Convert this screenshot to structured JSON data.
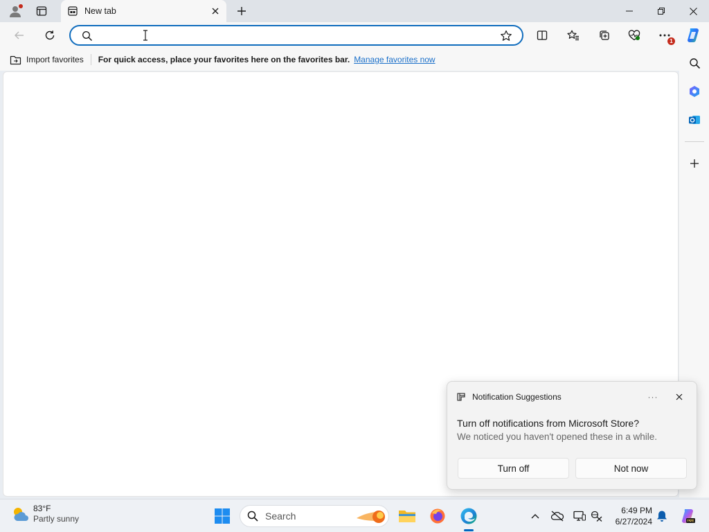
{
  "browser": {
    "tab": {
      "title": "New tab"
    },
    "address_bar": {
      "value": "",
      "placeholder": ""
    },
    "toolbar_icons": [
      "back-icon",
      "refresh-icon",
      "split-screen-icon",
      "favorites-icon",
      "collections-icon",
      "browser-essentials-icon",
      "more-icon",
      "copilot-icon"
    ],
    "settings_badge": "1"
  },
  "favorites_bar": {
    "import_label": "Import favorites",
    "message": "For quick access, place your favorites here on the favorites bar.",
    "link": "Manage favorites now"
  },
  "sidebar": {
    "items": [
      "search-icon",
      "office-icon",
      "outlook-icon",
      "add-icon"
    ]
  },
  "notification": {
    "header": "Notification Suggestions",
    "more": "···",
    "title": "Turn off notifications from Microsoft Store?",
    "body": "We noticed you haven't opened these in a while.",
    "primary": "Turn off",
    "secondary": "Not now"
  },
  "taskbar": {
    "weather": {
      "temp": "83°F",
      "condition": "Partly sunny"
    },
    "search_label": "Search",
    "clock": {
      "time": "6:49 PM",
      "date": "6/27/2024"
    }
  },
  "colors": {
    "accent": "#0f6cbd",
    "link": "#1a6fc9",
    "badge": "#c42b1c"
  }
}
